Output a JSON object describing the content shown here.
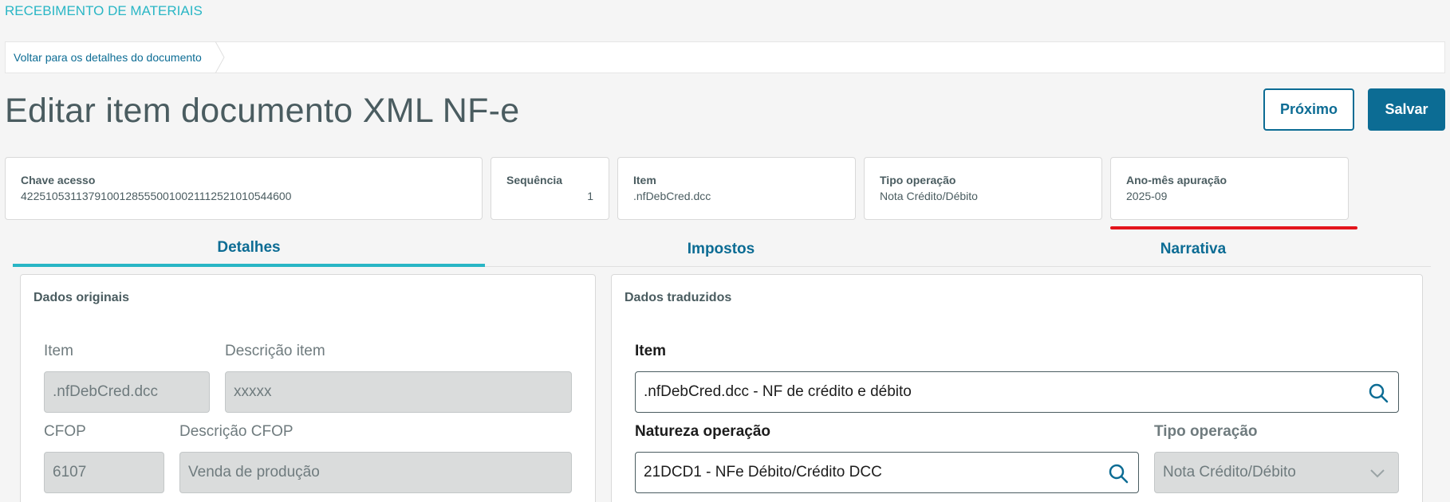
{
  "header": {
    "module_title": "RECEBIMENTO DE MATERIAIS",
    "breadcrumb": "Voltar para os detalhes do documento",
    "page_title": "Editar item documento XML NF-e"
  },
  "actions": {
    "next_label": "Próximo",
    "save_label": "Salvar"
  },
  "summary": {
    "access_key": {
      "label": "Chave acesso",
      "value": "42251053113791001285550010021112521010544600"
    },
    "sequence": {
      "label": "Sequência",
      "value": "1"
    },
    "item": {
      "label": "Item",
      "value": ".nfDebCred.dcc"
    },
    "operation_type": {
      "label": "Tipo operação",
      "value": "Nota Crédito/Débito"
    },
    "period": {
      "label": "Ano-mês apuração",
      "value": "2025-09"
    }
  },
  "tabs": [
    {
      "label": "Detalhes",
      "active": true
    },
    {
      "label": "Impostos",
      "active": false
    },
    {
      "label": "Narrativa",
      "active": false
    }
  ],
  "original": {
    "title": "Dados originais",
    "item_label": "Item",
    "item_value": ".nfDebCred.dcc",
    "item_desc_label": "Descrição item",
    "item_desc_value": "xxxxx",
    "cfop_label": "CFOP",
    "cfop_value": "6107",
    "cfop_desc_label": "Descrição CFOP",
    "cfop_desc_value": "Venda de produção"
  },
  "translated": {
    "title": "Dados traduzidos",
    "item_label": "Item",
    "item_value": ".nfDebCred.dcc - NF de crédito e débito",
    "nature_label": "Natureza operação",
    "nature_value": "21DCD1 - NFe Débito/Crédito DCC",
    "op_type_label": "Tipo operação",
    "op_type_value": "Nota Crédito/Débito"
  },
  "icons": {
    "search": "search-icon",
    "chevron": "chevron-down-icon",
    "breadcrumb_separator": "chevron-right-icon"
  },
  "colors": {
    "primary": "#0c6c94",
    "accent": "#29b6c5",
    "highlight": "#e3141b"
  }
}
